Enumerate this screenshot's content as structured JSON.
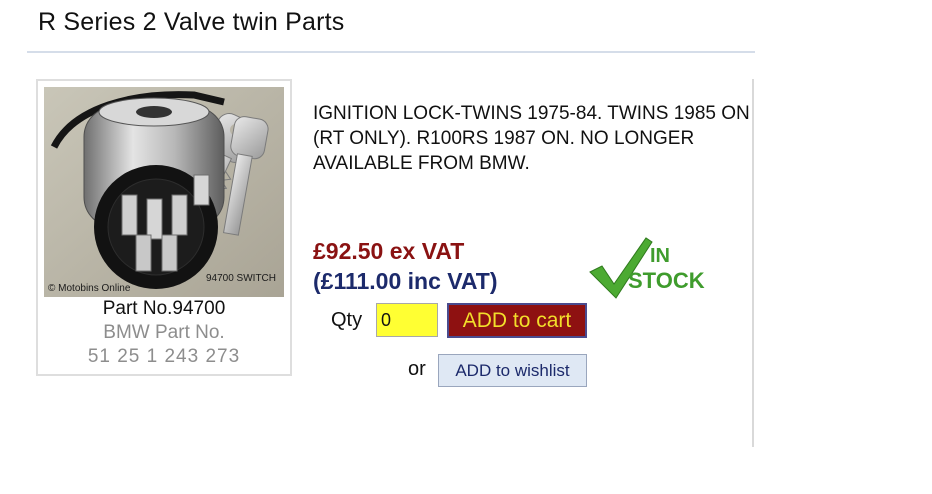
{
  "page": {
    "title": "R Series 2 Valve twin Parts"
  },
  "product": {
    "image": {
      "watermark": "© Motobins Online",
      "caption": "94700 SWITCH"
    },
    "part_no": "Part No.94700",
    "bmw_part_label": "BMW Part No.",
    "bmw_part_number": "51 25 1 243 273",
    "description": "IGNITION LOCK-TWINS 1975-84. TWINS 1985 ON (RT ONLY). R100RS 1987 ON. NO LONGER AVAILABLE FROM BMW.",
    "price_ex_vat": "£92.50 ex VAT",
    "price_inc_vat": "(£111.00 inc VAT)",
    "stock_badge": {
      "line1": "IN",
      "line2": "STOCK",
      "color": "#4caa32"
    }
  },
  "order": {
    "qty_label": "Qty",
    "qty_value": "0",
    "add_to_cart_label": "ADD to cart",
    "or_label": "or",
    "add_to_wishlist_label": "ADD to wishlist"
  },
  "colors": {
    "price_ex": "#8a1212",
    "price_inc": "#1c2a6b",
    "cart_bg": "#8e1111",
    "cart_text": "#f2de2b",
    "qty_bg": "#ffff33",
    "wishlist_bg": "#dfe8f4"
  }
}
